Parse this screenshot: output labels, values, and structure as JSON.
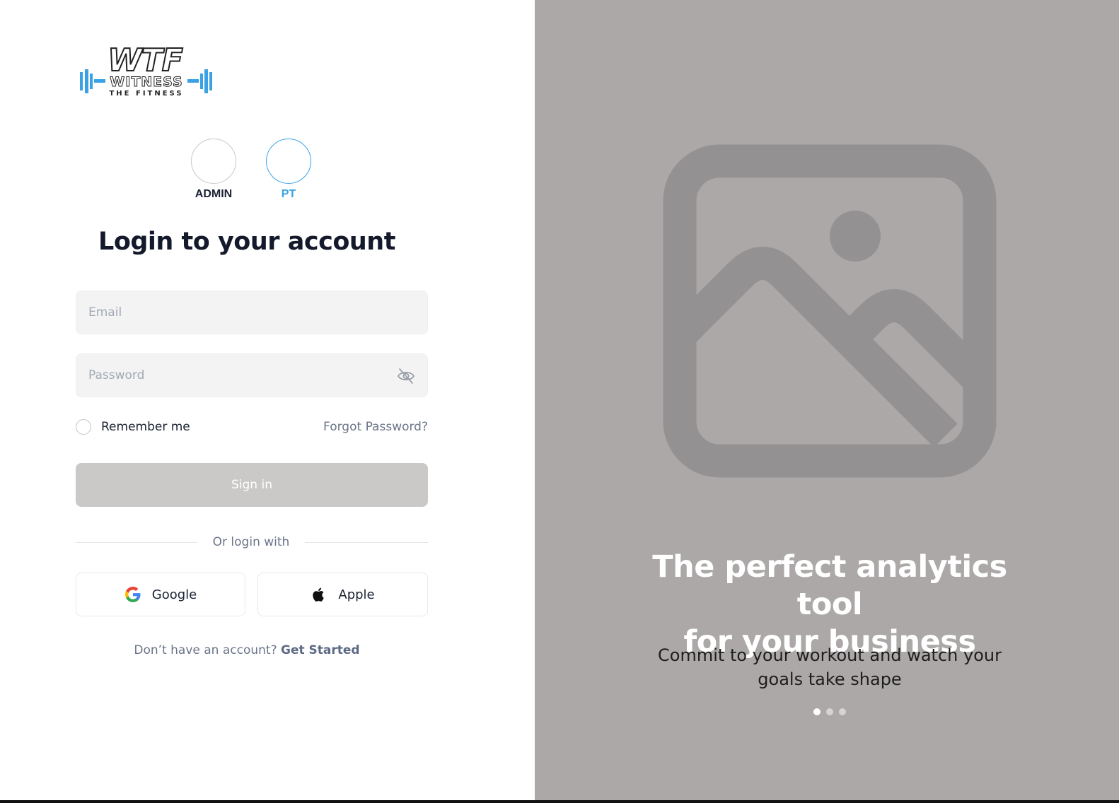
{
  "logo": {
    "title": "WTF",
    "wordmark": "WITNESS",
    "tagline": "THE FITNESS",
    "accent_color": "#3aa2e4"
  },
  "roles": {
    "admin": "ADMIN",
    "pt": "PT",
    "selected": "PT"
  },
  "form": {
    "title": "Login to your account",
    "email_placeholder": "Email",
    "password_placeholder": "Password",
    "password_toggle_icon": "eye-off-icon",
    "remember_label": "Remember me",
    "forgot_label": "Forgot Password?",
    "signin_label": "Sign in",
    "or_label": "Or login with",
    "google_label": "Google",
    "apple_label": "Apple",
    "signup_prompt": "Don’t have an account?",
    "signup_link": "Get Started"
  },
  "hero": {
    "image_icon": "image-placeholder-icon",
    "title_line1": "The perfect analytics tool",
    "title_line2": "for your business",
    "subtitle_line1": "Commit to your workout and watch your",
    "subtitle_line2": "goals take shape",
    "slide_count": 3,
    "active_slide": 1
  },
  "colors": {
    "panel_gray": "#aba8a7",
    "signin_disabled": "#cac9c8",
    "heading": "#141a2b",
    "muted_text": "#6b7589"
  }
}
